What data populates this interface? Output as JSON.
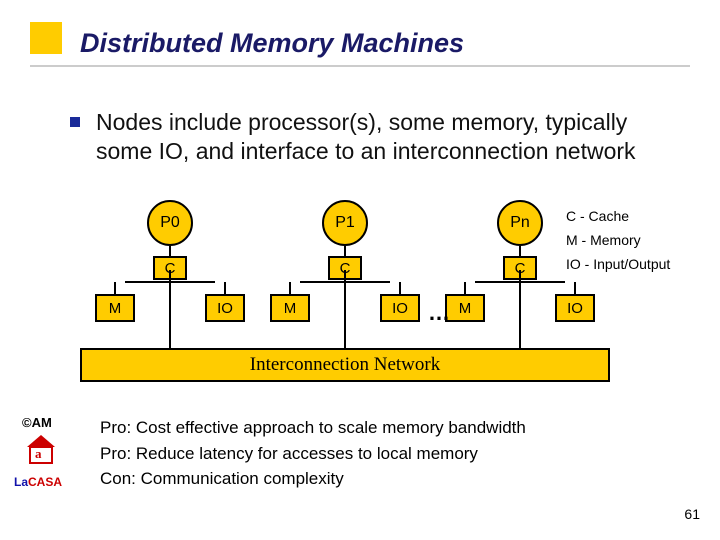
{
  "title": "Distributed Memory Machines",
  "bullet": "Nodes include processor(s), some memory, typically some IO, and interface to an interconnection network",
  "nodes": {
    "p0": "P0",
    "p1": "P1",
    "pn": "Pn",
    "c": "C",
    "m": "M",
    "io": "IO"
  },
  "dots": "…",
  "legend": {
    "c": "C - Cache",
    "m": "M - Memory",
    "io": "IO - Input/Output"
  },
  "network": "Interconnection Network",
  "procon": {
    "p1": "Pro: Cost effective approach to scale memory bandwidth",
    "p2": "Pro: Reduce latency for accesses to local memory",
    "c1": "Con: Communication complexity"
  },
  "footer": {
    "am": "©AM",
    "lacasa_la": "La",
    "lacasa_casa": "CASA",
    "page": "61"
  }
}
